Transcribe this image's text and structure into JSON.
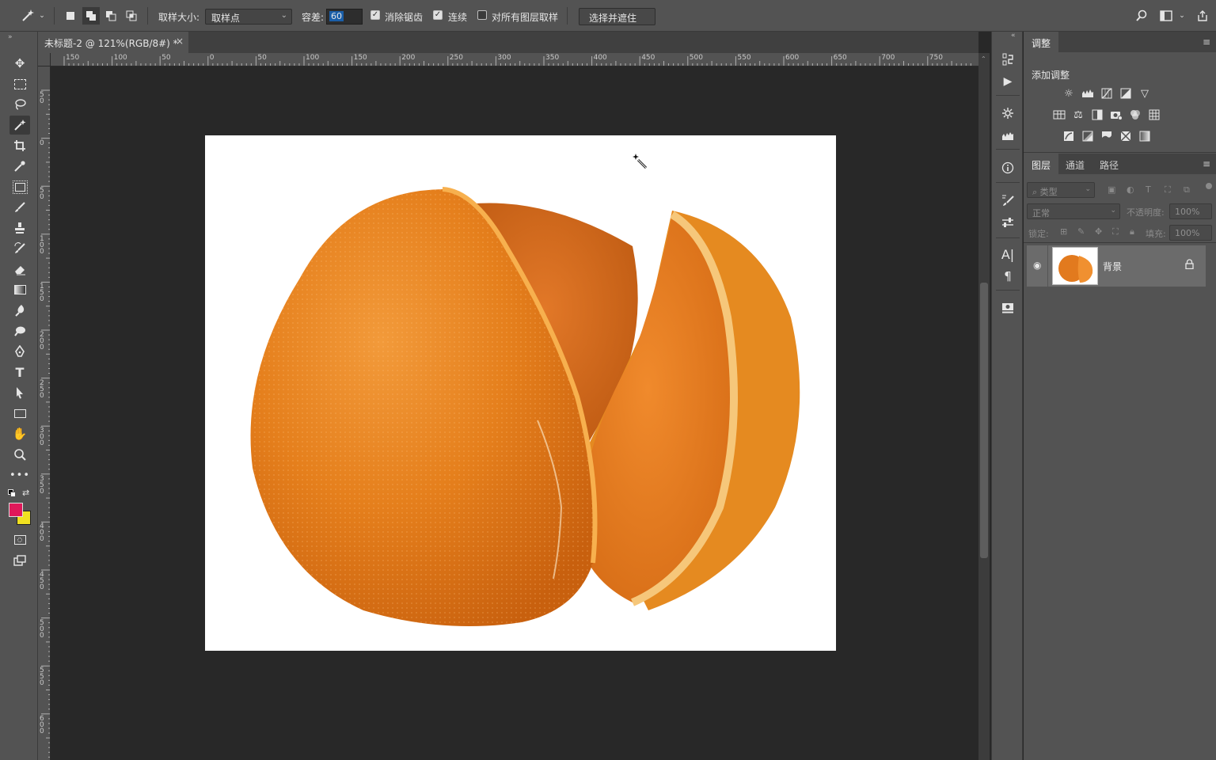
{
  "optbar": {
    "sample_size_label": "取样大小:",
    "sample_size_value": "取样点",
    "tolerance_label": "容差:",
    "tolerance_value": "60",
    "antialias_label": "消除锯齿",
    "contiguous_label": "连续",
    "all_layers_label": "对所有图层取样",
    "select_mask_button": "选择并遮住 ..."
  },
  "document": {
    "tab_title": "未标题-2 @ 121%(RGB/8#) *",
    "close": "×"
  },
  "rulers": {
    "h_ticks": [
      "150",
      "100",
      "50",
      "0",
      "50",
      "100",
      "150",
      "200",
      "250",
      "300",
      "350",
      "400",
      "450",
      "500",
      "550",
      "600",
      "650",
      "700",
      "750"
    ],
    "v_ticks": [
      "50",
      "0",
      "50",
      "100",
      "150",
      "200",
      "250",
      "300",
      "350",
      "400",
      "450",
      "500",
      "550",
      "600"
    ]
  },
  "adjustments": {
    "tab_label": "调整",
    "subtitle": "添加调整"
  },
  "layers_panel": {
    "tabs": [
      "图层",
      "通道",
      "路径"
    ],
    "filter_label": "类型",
    "blend_mode": "正常",
    "opacity_label": "不透明度:",
    "opacity_value": "100%",
    "lock_label": "锁定:",
    "fill_label": "填充:",
    "fill_value": "100%",
    "layers": [
      {
        "name": "背景",
        "visible": true,
        "locked": true
      }
    ]
  },
  "colors": {
    "foreground": "#e0185a",
    "background": "#f0e020",
    "orange": "#e8821c"
  }
}
